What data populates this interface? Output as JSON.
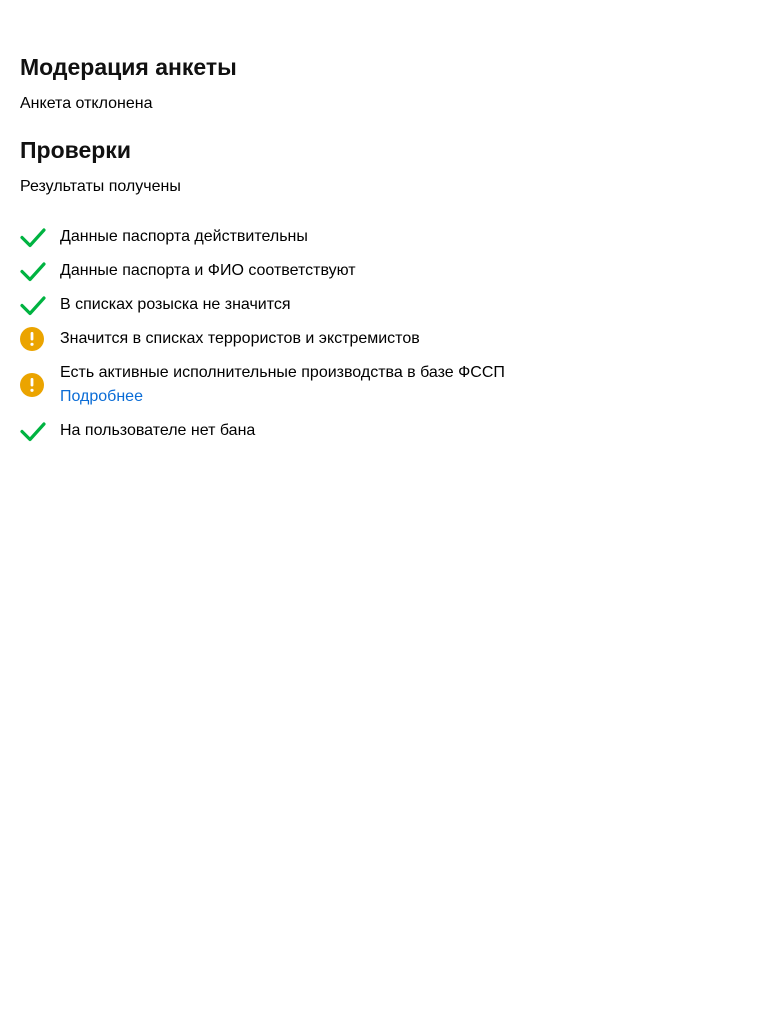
{
  "moderation": {
    "title": "Модерация анкеты",
    "status": "Анкета отклонена"
  },
  "checks": {
    "title": "Проверки",
    "status": "Результаты получены",
    "items": [
      {
        "icon": "checkmark-icon",
        "status": "ok",
        "text": "Данные паспорта действительны"
      },
      {
        "icon": "checkmark-icon",
        "status": "ok",
        "text": "Данные паспорта и ФИО соответствуют"
      },
      {
        "icon": "checkmark-icon",
        "status": "ok",
        "text": "В списках розыска не значится"
      },
      {
        "icon": "warning-icon",
        "status": "warning",
        "text": "Значится в списках террористов и экстремистов"
      },
      {
        "icon": "warning-icon",
        "status": "warning",
        "text": "Есть активные исполнительные производства в базе ФССП",
        "link": "Подробнее"
      },
      {
        "icon": "checkmark-icon",
        "status": "ok",
        "text": "На пользователе нет бана"
      }
    ]
  },
  "colors": {
    "ok": "#00b341",
    "warning": "#eba400",
    "link": "#0a6cd6"
  }
}
